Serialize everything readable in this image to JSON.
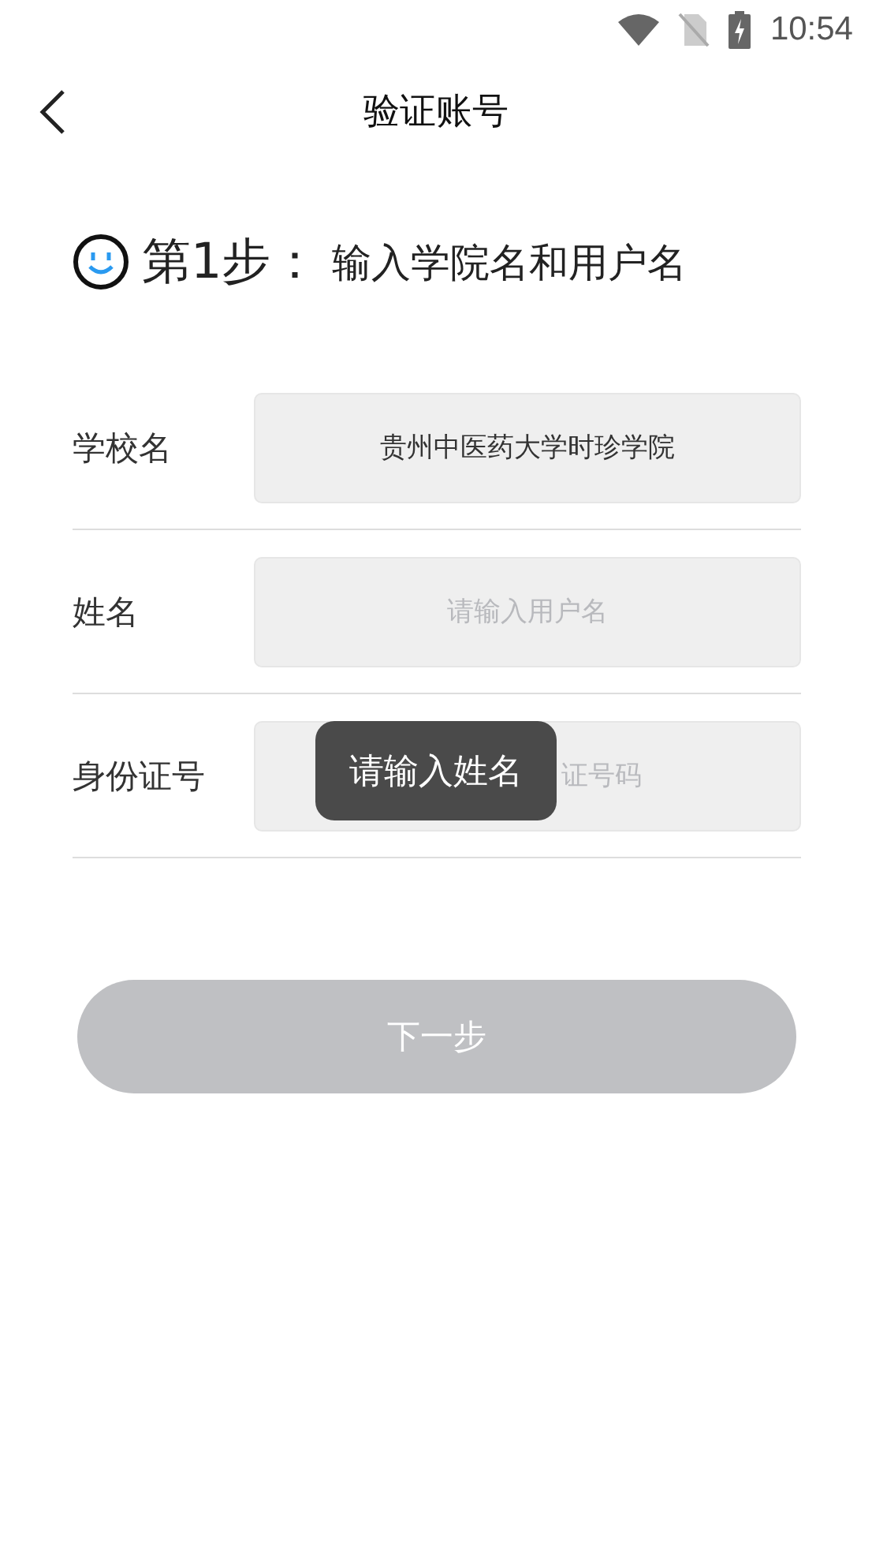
{
  "status_bar": {
    "time": "10:54"
  },
  "header": {
    "title": "验证账号"
  },
  "step": {
    "number": "第1步：",
    "text": "输入学院名和用户名"
  },
  "fields": [
    {
      "label": "学校名",
      "value": "贵州中医药大学时珍学院",
      "overlaid": false
    },
    {
      "label": "姓名",
      "placeholder": "请输入用户名",
      "overlaid": false
    },
    {
      "label": "身份证号",
      "placeholder": "证号码",
      "overlaid": true
    }
  ],
  "next_button": {
    "label": "下一步",
    "disabled": true
  },
  "toast": {
    "text": "请输入姓名"
  }
}
